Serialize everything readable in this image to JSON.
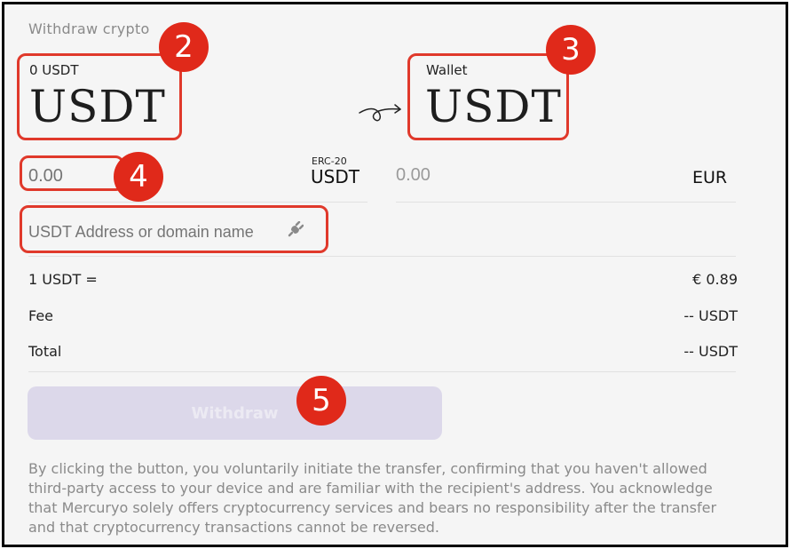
{
  "title": "Withdraw crypto",
  "from": {
    "balance": "0 USDT",
    "code": "USDT"
  },
  "to": {
    "label": "Wallet",
    "code": "USDT"
  },
  "amount": {
    "placeholder": "0.00",
    "network": "ERC-20",
    "ticker": "USDT"
  },
  "fiat": {
    "amount": "0.00",
    "ticker": "EUR"
  },
  "address": {
    "placeholder": "USDT Address or domain name"
  },
  "rows": [
    {
      "label": "1 USDT =",
      "value": "€ 0.89"
    },
    {
      "label": "Fee",
      "value": "-- USDT"
    },
    {
      "label": "Total",
      "value": "-- USDT"
    }
  ],
  "withdraw_button": {
    "label": "Withdraw"
  },
  "disclaimer": "By clicking the button, you voluntarily initiate the transfer, confirming that you haven't allowed third-party access to your device and are familiar with the recipient's address. You acknowledge that Mercuryo solely offers cryptocurrency services and bears no responsibility after the transfer and that cryptocurrency transactions cannot be reversed.",
  "callouts": [
    "2",
    "3",
    "4",
    "5"
  ],
  "colors": {
    "highlight": "#e0392b",
    "badge": "#e0291a",
    "button_disabled": "#dcd8ea"
  },
  "icons": {
    "arrow": "curved-arrow-icon",
    "address": "plug-icon"
  }
}
